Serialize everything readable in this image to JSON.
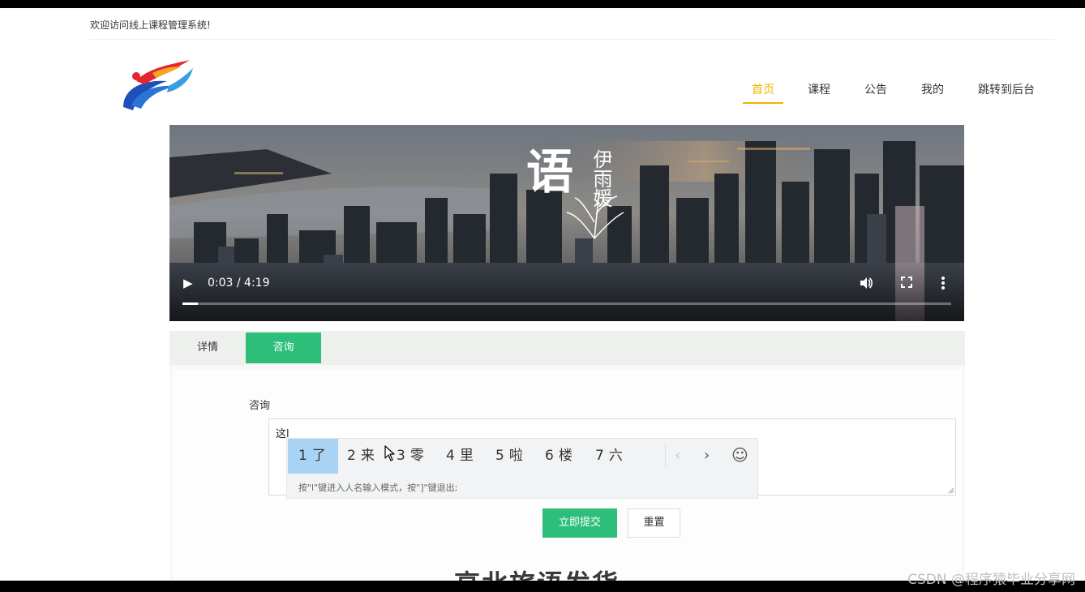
{
  "header": {
    "welcome_text": "欢迎访问线上课程管理系统!"
  },
  "nav": {
    "items": [
      "首页",
      "课程",
      "公告",
      "我的",
      "跳转到后台"
    ],
    "active_color": "#f0b400"
  },
  "video": {
    "poster_text_1": "语",
    "poster_text_2": "伊雨媛",
    "time_display": "0:03 / 4:19",
    "progress_fraction": 0.02,
    "icons": [
      "play-icon",
      "volume-icon",
      "fullscreen-icon",
      "more-vertical-icon"
    ]
  },
  "tabs": {
    "items": [
      "详情",
      "咨询"
    ],
    "active_color": "#2dbf7a"
  },
  "form": {
    "label": "咨询",
    "textarea_value": "这l",
    "submit_label": "立即提交",
    "reset_label": "重置"
  },
  "ime": {
    "candidates": [
      {
        "num": "1",
        "text": "了"
      },
      {
        "num": "2",
        "text": "来"
      },
      {
        "num": "3",
        "text": "零"
      },
      {
        "num": "4",
        "text": "里"
      },
      {
        "num": "5",
        "text": "啦"
      },
      {
        "num": "6",
        "text": "楼"
      },
      {
        "num": "7",
        "text": "六"
      }
    ],
    "prev": "‹",
    "next": "›",
    "emoji": "☺",
    "hint": "按\"l\"键进入人名输入模式，按\"]\"键退出;"
  },
  "content": {
    "section_title": "高北旅语发货"
  },
  "watermark": "CSDN @程序猿毕业分享网"
}
